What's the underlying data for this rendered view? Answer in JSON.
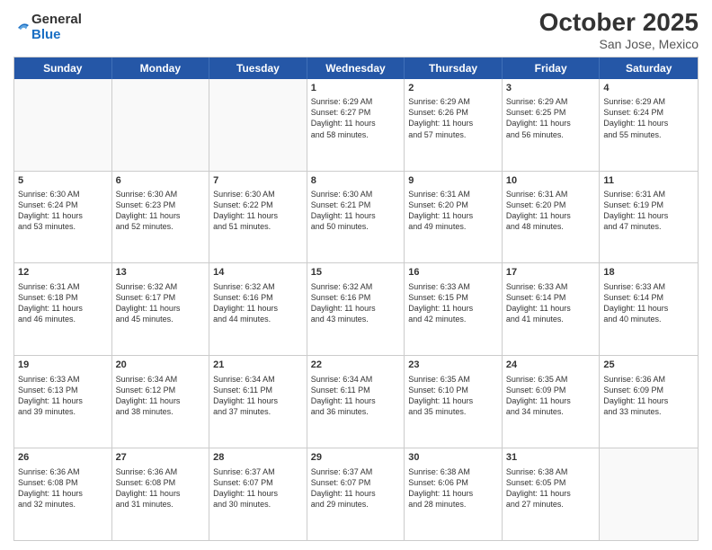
{
  "header": {
    "logo_general": "General",
    "logo_blue": "Blue",
    "month": "October 2025",
    "location": "San Jose, Mexico"
  },
  "days_of_week": [
    "Sunday",
    "Monday",
    "Tuesday",
    "Wednesday",
    "Thursday",
    "Friday",
    "Saturday"
  ],
  "weeks": [
    [
      {
        "day": "",
        "text": ""
      },
      {
        "day": "",
        "text": ""
      },
      {
        "day": "",
        "text": ""
      },
      {
        "day": "1",
        "text": "Sunrise: 6:29 AM\nSunset: 6:27 PM\nDaylight: 11 hours\nand 58 minutes."
      },
      {
        "day": "2",
        "text": "Sunrise: 6:29 AM\nSunset: 6:26 PM\nDaylight: 11 hours\nand 57 minutes."
      },
      {
        "day": "3",
        "text": "Sunrise: 6:29 AM\nSunset: 6:25 PM\nDaylight: 11 hours\nand 56 minutes."
      },
      {
        "day": "4",
        "text": "Sunrise: 6:29 AM\nSunset: 6:24 PM\nDaylight: 11 hours\nand 55 minutes."
      }
    ],
    [
      {
        "day": "5",
        "text": "Sunrise: 6:30 AM\nSunset: 6:24 PM\nDaylight: 11 hours\nand 53 minutes."
      },
      {
        "day": "6",
        "text": "Sunrise: 6:30 AM\nSunset: 6:23 PM\nDaylight: 11 hours\nand 52 minutes."
      },
      {
        "day": "7",
        "text": "Sunrise: 6:30 AM\nSunset: 6:22 PM\nDaylight: 11 hours\nand 51 minutes."
      },
      {
        "day": "8",
        "text": "Sunrise: 6:30 AM\nSunset: 6:21 PM\nDaylight: 11 hours\nand 50 minutes."
      },
      {
        "day": "9",
        "text": "Sunrise: 6:31 AM\nSunset: 6:20 PM\nDaylight: 11 hours\nand 49 minutes."
      },
      {
        "day": "10",
        "text": "Sunrise: 6:31 AM\nSunset: 6:20 PM\nDaylight: 11 hours\nand 48 minutes."
      },
      {
        "day": "11",
        "text": "Sunrise: 6:31 AM\nSunset: 6:19 PM\nDaylight: 11 hours\nand 47 minutes."
      }
    ],
    [
      {
        "day": "12",
        "text": "Sunrise: 6:31 AM\nSunset: 6:18 PM\nDaylight: 11 hours\nand 46 minutes."
      },
      {
        "day": "13",
        "text": "Sunrise: 6:32 AM\nSunset: 6:17 PM\nDaylight: 11 hours\nand 45 minutes."
      },
      {
        "day": "14",
        "text": "Sunrise: 6:32 AM\nSunset: 6:16 PM\nDaylight: 11 hours\nand 44 minutes."
      },
      {
        "day": "15",
        "text": "Sunrise: 6:32 AM\nSunset: 6:16 PM\nDaylight: 11 hours\nand 43 minutes."
      },
      {
        "day": "16",
        "text": "Sunrise: 6:33 AM\nSunset: 6:15 PM\nDaylight: 11 hours\nand 42 minutes."
      },
      {
        "day": "17",
        "text": "Sunrise: 6:33 AM\nSunset: 6:14 PM\nDaylight: 11 hours\nand 41 minutes."
      },
      {
        "day": "18",
        "text": "Sunrise: 6:33 AM\nSunset: 6:14 PM\nDaylight: 11 hours\nand 40 minutes."
      }
    ],
    [
      {
        "day": "19",
        "text": "Sunrise: 6:33 AM\nSunset: 6:13 PM\nDaylight: 11 hours\nand 39 minutes."
      },
      {
        "day": "20",
        "text": "Sunrise: 6:34 AM\nSunset: 6:12 PM\nDaylight: 11 hours\nand 38 minutes."
      },
      {
        "day": "21",
        "text": "Sunrise: 6:34 AM\nSunset: 6:11 PM\nDaylight: 11 hours\nand 37 minutes."
      },
      {
        "day": "22",
        "text": "Sunrise: 6:34 AM\nSunset: 6:11 PM\nDaylight: 11 hours\nand 36 minutes."
      },
      {
        "day": "23",
        "text": "Sunrise: 6:35 AM\nSunset: 6:10 PM\nDaylight: 11 hours\nand 35 minutes."
      },
      {
        "day": "24",
        "text": "Sunrise: 6:35 AM\nSunset: 6:09 PM\nDaylight: 11 hours\nand 34 minutes."
      },
      {
        "day": "25",
        "text": "Sunrise: 6:36 AM\nSunset: 6:09 PM\nDaylight: 11 hours\nand 33 minutes."
      }
    ],
    [
      {
        "day": "26",
        "text": "Sunrise: 6:36 AM\nSunset: 6:08 PM\nDaylight: 11 hours\nand 32 minutes."
      },
      {
        "day": "27",
        "text": "Sunrise: 6:36 AM\nSunset: 6:08 PM\nDaylight: 11 hours\nand 31 minutes."
      },
      {
        "day": "28",
        "text": "Sunrise: 6:37 AM\nSunset: 6:07 PM\nDaylight: 11 hours\nand 30 minutes."
      },
      {
        "day": "29",
        "text": "Sunrise: 6:37 AM\nSunset: 6:07 PM\nDaylight: 11 hours\nand 29 minutes."
      },
      {
        "day": "30",
        "text": "Sunrise: 6:38 AM\nSunset: 6:06 PM\nDaylight: 11 hours\nand 28 minutes."
      },
      {
        "day": "31",
        "text": "Sunrise: 6:38 AM\nSunset: 6:05 PM\nDaylight: 11 hours\nand 27 minutes."
      },
      {
        "day": "",
        "text": ""
      }
    ]
  ]
}
